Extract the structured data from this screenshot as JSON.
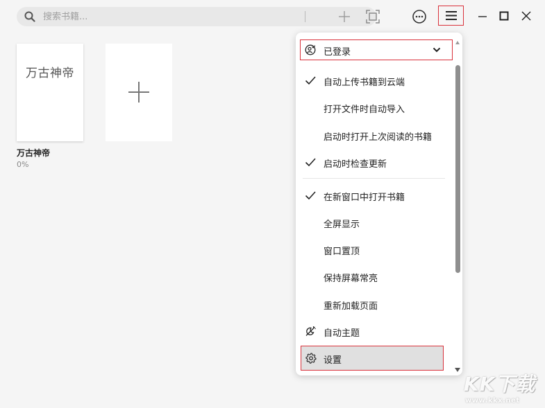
{
  "search": {
    "placeholder": "搜索书籍..."
  },
  "toolbar": {
    "add_icon": "plus-icon",
    "scan_icon": "fullscreen-scan-icon",
    "more_icon": "more-horizontal-circle-icon",
    "menu_icon": "hamburger-menu-icon"
  },
  "window_controls": [
    "minimize-icon",
    "maximize-icon",
    "close-icon"
  ],
  "library": {
    "books": [
      {
        "cover_title": "万古神帝",
        "name": "万古神帝",
        "progress": "0%"
      }
    ],
    "add_book_icon": "plus-icon"
  },
  "menu": {
    "account": {
      "label": "已登录",
      "icon": "user-circle-check-icon",
      "chevron": "chevron-down-icon"
    },
    "items": [
      {
        "label": "自动上传书籍到云端",
        "checked": true
      },
      {
        "label": "打开文件时自动导入",
        "checked": false
      },
      {
        "label": "启动时打开上次阅读的书籍",
        "checked": false
      },
      {
        "label": "启动时检查更新",
        "checked": true
      },
      {
        "label": "在新窗口中打开书籍",
        "checked": true
      },
      {
        "label": "全屏显示",
        "checked": false
      },
      {
        "label": "窗口置顶",
        "checked": false
      },
      {
        "label": "保持屏幕常亮",
        "checked": false
      },
      {
        "label": "重新加载页面",
        "checked": false
      }
    ],
    "theme": {
      "label": "自动主题",
      "icon": "auto-theme-icon"
    },
    "settings": {
      "label": "设置",
      "icon": "gear-icon"
    }
  },
  "watermark": {
    "logo": "KK下载",
    "url": "www.kkx.net"
  },
  "colors": {
    "background": "#f5f5f5",
    "highlight_border": "#d9303a",
    "menu_selected_bg": "#e0e0e0"
  }
}
